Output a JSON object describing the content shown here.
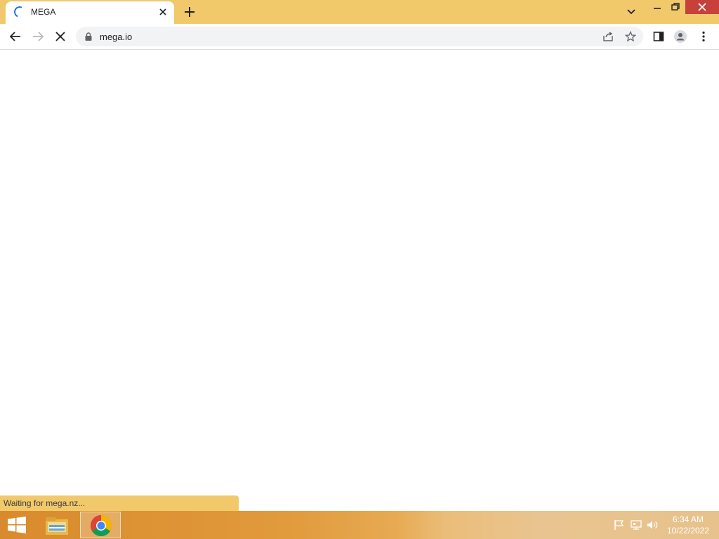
{
  "browser": {
    "tab": {
      "title": "MEGA"
    },
    "omnibox": {
      "url": "mega.io"
    },
    "status_text": "Waiting for mega.nz..."
  },
  "taskbar": {
    "time": "6:34 AM",
    "date": "10/22/2022"
  },
  "colors": {
    "frame": "#f1c96a",
    "spinner": "#1a73e8",
    "close_button": "#c7413a"
  }
}
